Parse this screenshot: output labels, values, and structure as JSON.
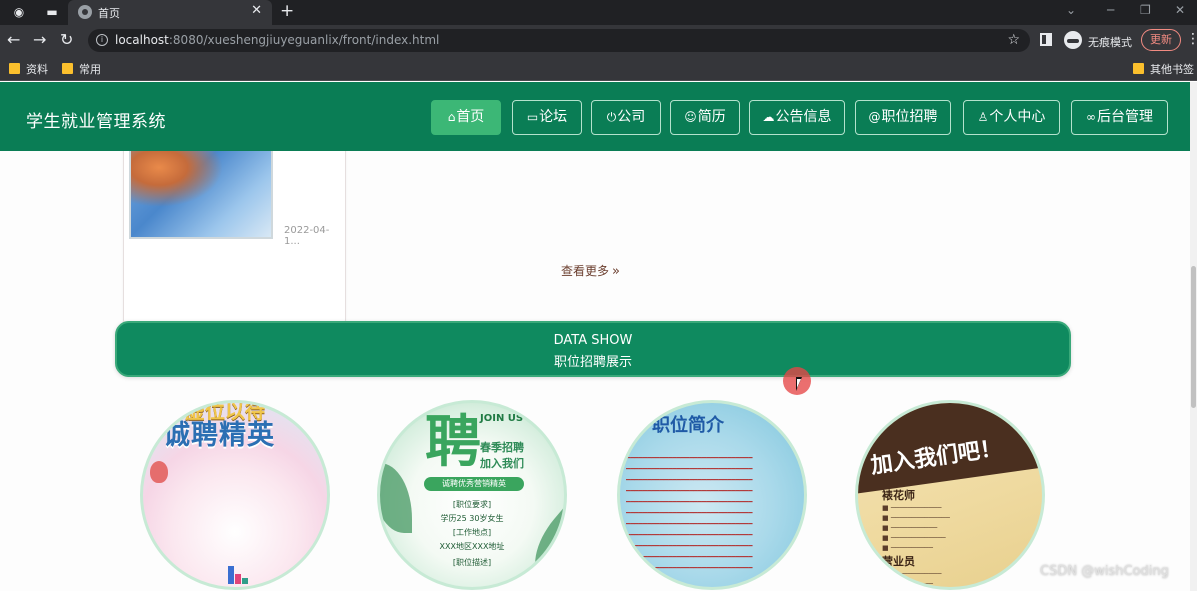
{
  "browser": {
    "tab_title": "首页",
    "url_host": "localhost",
    "url_rest": ":8080/xueshengjiuyeguanlix/front/index.html",
    "incognito_label": "无痕模式",
    "update_label": "更新",
    "bookmarks": [
      "资料",
      "常用"
    ],
    "other_bookmarks": "其他书签"
  },
  "navbar": {
    "brand": "学生就业管理系统",
    "items": [
      {
        "label": "首页",
        "icon": "home-icon",
        "glyph": "⌂",
        "active": true
      },
      {
        "label": "论坛",
        "icon": "chat-icon",
        "glyph": "≡",
        "active": false
      },
      {
        "label": "公司",
        "icon": "power-icon",
        "glyph": "◌",
        "active": false
      },
      {
        "label": "简历",
        "icon": "smile-icon",
        "glyph": "◌",
        "active": false
      },
      {
        "label": "公告信息",
        "icon": "cloud-icon",
        "glyph": "◌",
        "active": false
      },
      {
        "label": "职位招聘",
        "icon": "at-icon",
        "glyph": "◌",
        "active": false
      },
      {
        "label": "个人中心",
        "icon": "user-icon",
        "glyph": "◌",
        "active": false
      },
      {
        "label": "后台管理",
        "icon": "link-icon",
        "glyph": "∞",
        "active": false
      }
    ]
  },
  "news": {
    "date": "2022-04-1..."
  },
  "more_link": "查看更多",
  "banner": {
    "title_en": "DATA SHOW",
    "title_zh": "职位招聘展示"
  },
  "jobs": {
    "card1": {
      "head": "诚聘精英",
      "sub": "虚位以待"
    },
    "card2": {
      "big": "聘",
      "join": "JOIN US",
      "hire": "春季招聘\n加入我们",
      "bar": "诚聘优秀营销精英",
      "lines": [
        "[职位要求]",
        "学历25 30岁女生",
        "[工作地点]",
        "XXX地区XXX地址",
        "[职位描述]"
      ]
    },
    "card3": {
      "title": "职位简介"
    },
    "card4": {
      "head": "加入我们吧！",
      "role1": "裱花师",
      "role2": "营业员"
    }
  },
  "watermark": "CSDN @wishCoding",
  "colors": {
    "nav_bg": "#0a7d55",
    "nav_active": "#3cb776",
    "banner_bg": "#0f8a5f"
  }
}
